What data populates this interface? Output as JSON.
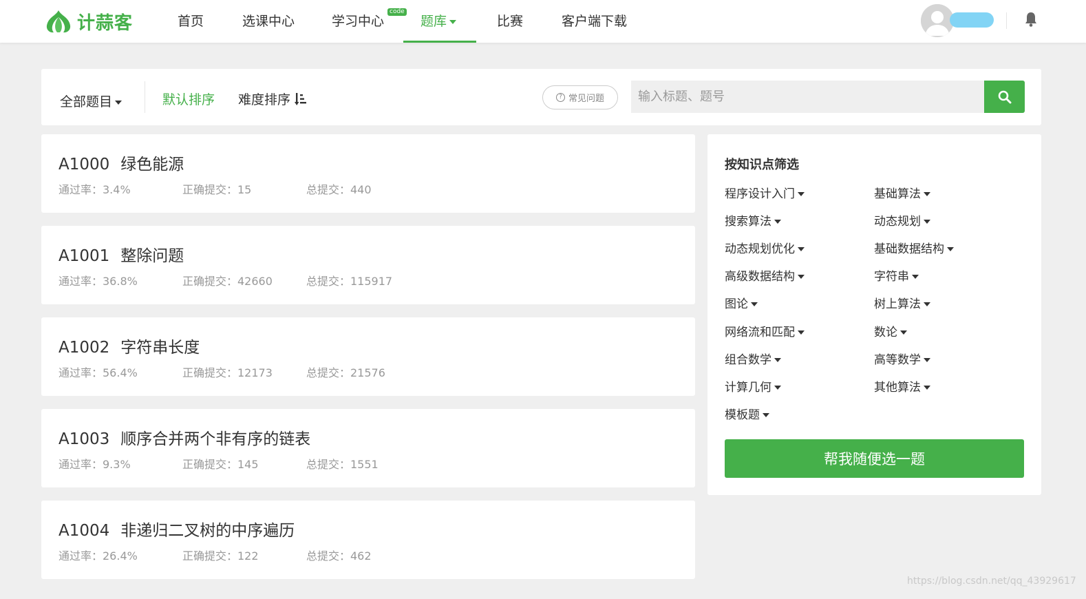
{
  "header": {
    "logo_text": "计蒜客",
    "nav": [
      {
        "label": "首页"
      },
      {
        "label": "选课中心"
      },
      {
        "label": "学习中心",
        "badge": "code"
      },
      {
        "label": "题库",
        "active": true
      },
      {
        "label": "比赛"
      },
      {
        "label": "客户端下载"
      }
    ]
  },
  "filter": {
    "all_problems": "全部题目",
    "sort_default": "默认排序",
    "sort_difficulty": "难度排序",
    "faq": "常见问题",
    "search_placeholder": "输入标题、题号"
  },
  "problems": [
    {
      "id": "A1000",
      "title": "绿色能源",
      "pass_rate_label": "通过率：3.4%",
      "correct_label": "正确提交：15",
      "total_label": "总提交：440"
    },
    {
      "id": "A1001",
      "title": "整除问题",
      "pass_rate_label": "通过率：36.8%",
      "correct_label": "正确提交：42660",
      "total_label": "总提交：115917"
    },
    {
      "id": "A1002",
      "title": "字符串长度",
      "pass_rate_label": "通过率：56.4%",
      "correct_label": "正确提交：12173",
      "total_label": "总提交：21576"
    },
    {
      "id": "A1003",
      "title": "顺序合并两个非有序的链表",
      "pass_rate_label": "通过率：9.3%",
      "correct_label": "正确提交：145",
      "total_label": "总提交：1551"
    },
    {
      "id": "A1004",
      "title": "非递归二叉树的中序遍历",
      "pass_rate_label": "通过率：26.4%",
      "correct_label": "正确提交：122",
      "total_label": "总提交：462"
    }
  ],
  "sidebar": {
    "title": "按知识点筛选",
    "tags": [
      "程序设计入门",
      "基础算法",
      "搜索算法",
      "动态规划",
      "动态规划优化",
      "基础数据结构",
      "高级数据结构",
      "字符串",
      "图论",
      "树上算法",
      "网络流和匹配",
      "数论",
      "组合数学",
      "高等数学",
      "计算几何",
      "其他算法",
      "模板题"
    ],
    "random_button": "帮我随便选一题"
  },
  "colors": {
    "brand_green": "#45b04a",
    "background": "#efefef"
  },
  "watermark": "https://blog.csdn.net/qq_43929617"
}
